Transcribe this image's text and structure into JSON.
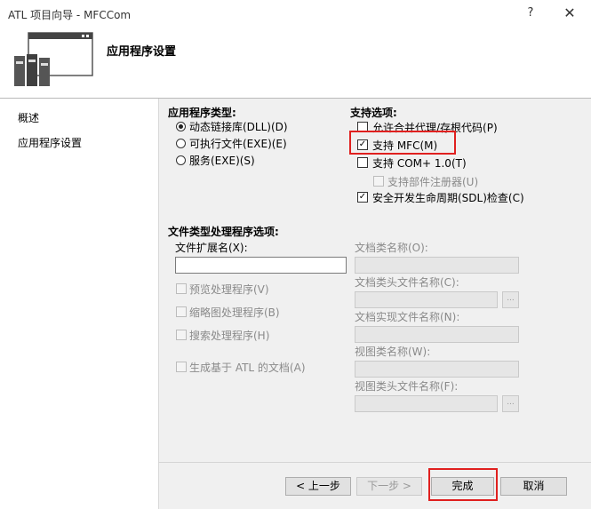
{
  "window": {
    "title": "ATL 项目向导 - MFCCom",
    "help": "?",
    "close": "✕"
  },
  "header": {
    "title": "应用程序设置"
  },
  "sidebar": {
    "items": [
      {
        "label": "概述"
      },
      {
        "label": "应用程序设置"
      }
    ]
  },
  "app_type": {
    "title": "应用程序类型:",
    "options": [
      {
        "label": "动态链接库(DLL)(D)",
        "selected": true
      },
      {
        "label": "可执行文件(EXE)(E)",
        "selected": false
      },
      {
        "label": "服务(EXE)(S)",
        "selected": false
      }
    ]
  },
  "support": {
    "title": "支持选项:",
    "options": [
      {
        "label": "允许合并代理/存根代码(P)",
        "checked": false,
        "enabled": true
      },
      {
        "label": "支持 MFC(M)",
        "checked": true,
        "enabled": true
      },
      {
        "label": "支持 COM+ 1.0(T)",
        "checked": false,
        "enabled": true
      },
      {
        "label": "支持部件注册器(U)",
        "checked": false,
        "enabled": false
      },
      {
        "label": "安全开发生命周期(SDL)检查(C)",
        "checked": true,
        "enabled": true
      }
    ]
  },
  "file_type": {
    "title": "文件类型处理程序选项:",
    "ext_label": "文件扩展名(X):",
    "ext_value": "",
    "handlers": [
      {
        "label": "预览处理程序(V)"
      },
      {
        "label": "缩略图处理程序(B)"
      },
      {
        "label": "搜索处理程序(H)"
      },
      {
        "label": "生成基于 ATL 的文档(A)"
      }
    ],
    "doc_fields": [
      {
        "label": "文档类名称(O):"
      },
      {
        "label": "文档类头文件名称(C):"
      },
      {
        "label": "文档实现文件名称(N):"
      },
      {
        "label": "视图类名称(W):"
      },
      {
        "label": "视图类头文件名称(F):"
      }
    ],
    "browse": "..."
  },
  "footer": {
    "prev": "< 上一步",
    "next": "下一步 >",
    "finish": "完成",
    "cancel": "取消"
  },
  "colors": {
    "highlight": "#e0201f"
  }
}
